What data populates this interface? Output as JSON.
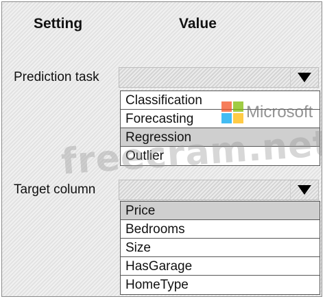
{
  "headers": {
    "setting": "Setting",
    "value": "Value"
  },
  "prediction_task": {
    "label": "Prediction task",
    "selected": "",
    "icon": "dropdown-arrow-icon",
    "options": [
      {
        "label": "Classification",
        "highlighted": false
      },
      {
        "label": "Forecasting",
        "highlighted": false
      },
      {
        "label": "Regression",
        "highlighted": true
      },
      {
        "label": "Outlier",
        "highlighted": false
      }
    ]
  },
  "target_column": {
    "label": "Target column",
    "selected": "",
    "icon": "dropdown-arrow-icon",
    "options": [
      {
        "label": "Price",
        "highlighted": true
      },
      {
        "label": "Bedrooms",
        "highlighted": false
      },
      {
        "label": "Size",
        "highlighted": false
      },
      {
        "label": "HasGarage",
        "highlighted": false
      },
      {
        "label": "HomeType",
        "highlighted": false
      }
    ]
  },
  "watermarks": {
    "logo_text": "Microsoft",
    "logo_colors": [
      "#f35325",
      "#81bc06",
      "#05a6f0",
      "#ffba08"
    ],
    "site_text": "freecram.net"
  },
  "colors": {
    "highlight": "#cfcfcf",
    "dropdown_bg": "#dcdcdc",
    "list_border": "#555555"
  }
}
